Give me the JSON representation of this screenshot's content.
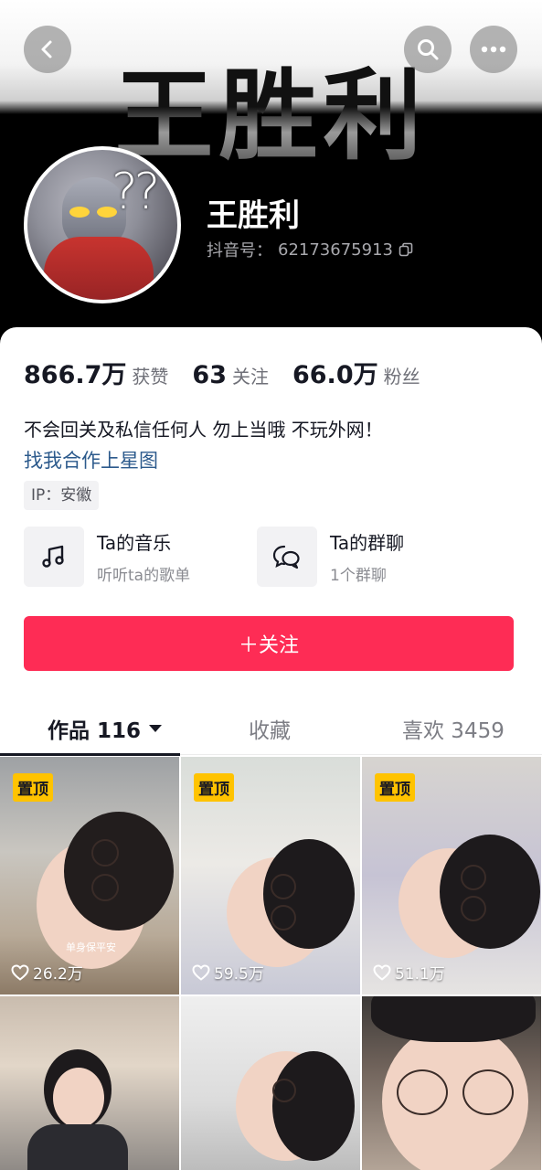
{
  "header": {
    "banner_text": "王胜利",
    "nickname": "王胜利",
    "account_label": "抖音号：",
    "account_id": "62173675913"
  },
  "icons": {
    "back": "back-icon",
    "search": "search-icon",
    "more": "more-icon",
    "copy": "copy-icon",
    "music": "music-note-icon",
    "group": "group-chat-icon",
    "heart": "heart-icon",
    "dropdown": "caret-down-icon"
  },
  "stats": [
    {
      "value": "866.7万",
      "label": "获赞"
    },
    {
      "value": "63",
      "label": "关注"
    },
    {
      "value": "66.0万",
      "label": "粉丝"
    }
  ],
  "bio": {
    "text": "不会回关及私信任何人 勿上当哦 不玩外网！",
    "link": "找我合作上星图",
    "ip": "IP：安徽"
  },
  "entries": [
    {
      "title": "Ta的音乐",
      "sub": "听听ta的歌单"
    },
    {
      "title": "Ta的群聊",
      "sub": "1个群聊"
    }
  ],
  "follow_button": "＋关注",
  "tabs": [
    {
      "label": "作品 116"
    },
    {
      "label": "收藏"
    },
    {
      "label": "喜欢 3459"
    }
  ],
  "videos": [
    {
      "pinned": "置顶",
      "likes": "26.2万",
      "caption": "单身保平安"
    },
    {
      "pinned": "置顶",
      "likes": "59.5万"
    },
    {
      "pinned": "置顶",
      "likes": "51.1万"
    },
    {},
    {},
    {}
  ],
  "colors": {
    "accent": "#fe2c55",
    "pin": "#ffc300",
    "link": "#2c5a8c"
  }
}
